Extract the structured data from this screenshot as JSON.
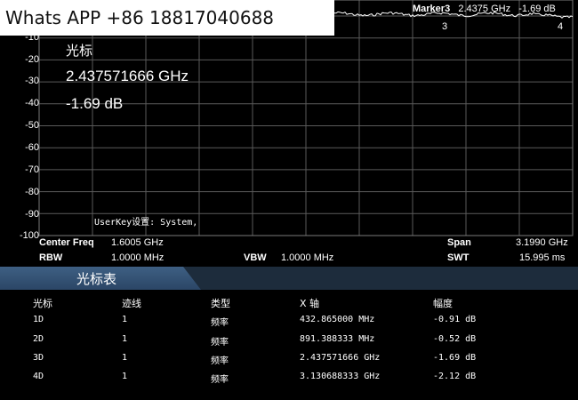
{
  "watermark": "Whats APP +86 18817040688",
  "marker_readout": {
    "name": "Marker3",
    "freq": "2.4375 GHz",
    "amp": "-1.69 dB"
  },
  "marker_flags": [
    "3",
    "4"
  ],
  "y_axis": {
    "labels": [
      "-10",
      "-20",
      "-30",
      "-40",
      "-50",
      "-60",
      "-70",
      "-80",
      "-90",
      "-100"
    ]
  },
  "marker_info": {
    "title": "光标",
    "freq": "2.437571666 GHz",
    "amp": "-1.69 dB"
  },
  "userkey_text": "UserKey设置:   System,",
  "settings": {
    "center_label": "Center Freq",
    "center_value": "1.6005 GHz",
    "span_label": "Span",
    "span_value": "3.1990 GHz",
    "rbw_label": "RBW",
    "rbw_value": "1.0000 MHz",
    "vbw_label": "VBW",
    "vbw_value": "1.0000 MHz",
    "swt_label": "SWT",
    "swt_value": "15.995 ms"
  },
  "marker_table": {
    "title": "光标表",
    "headers": [
      "光标",
      "迹线",
      "类型",
      "X 轴",
      "幅度"
    ],
    "rows": [
      [
        "1D",
        "1",
        "频率",
        "432.865000 MHz",
        "-0.91 dB"
      ],
      [
        "2D",
        "1",
        "频率",
        "891.388333 MHz",
        "-0.52 dB"
      ],
      [
        "3D",
        "1",
        "频率",
        "2.437571666 GHz",
        "-1.69 dB"
      ],
      [
        "4D",
        "1",
        "频率",
        "3.130688333 GHz",
        "-2.12 dB"
      ]
    ]
  },
  "colors": {
    "grid": "#5a5a5a",
    "trace": "#ffffff",
    "panel_tab": "#34527a",
    "panel_bar": "#1d2c3c"
  }
}
